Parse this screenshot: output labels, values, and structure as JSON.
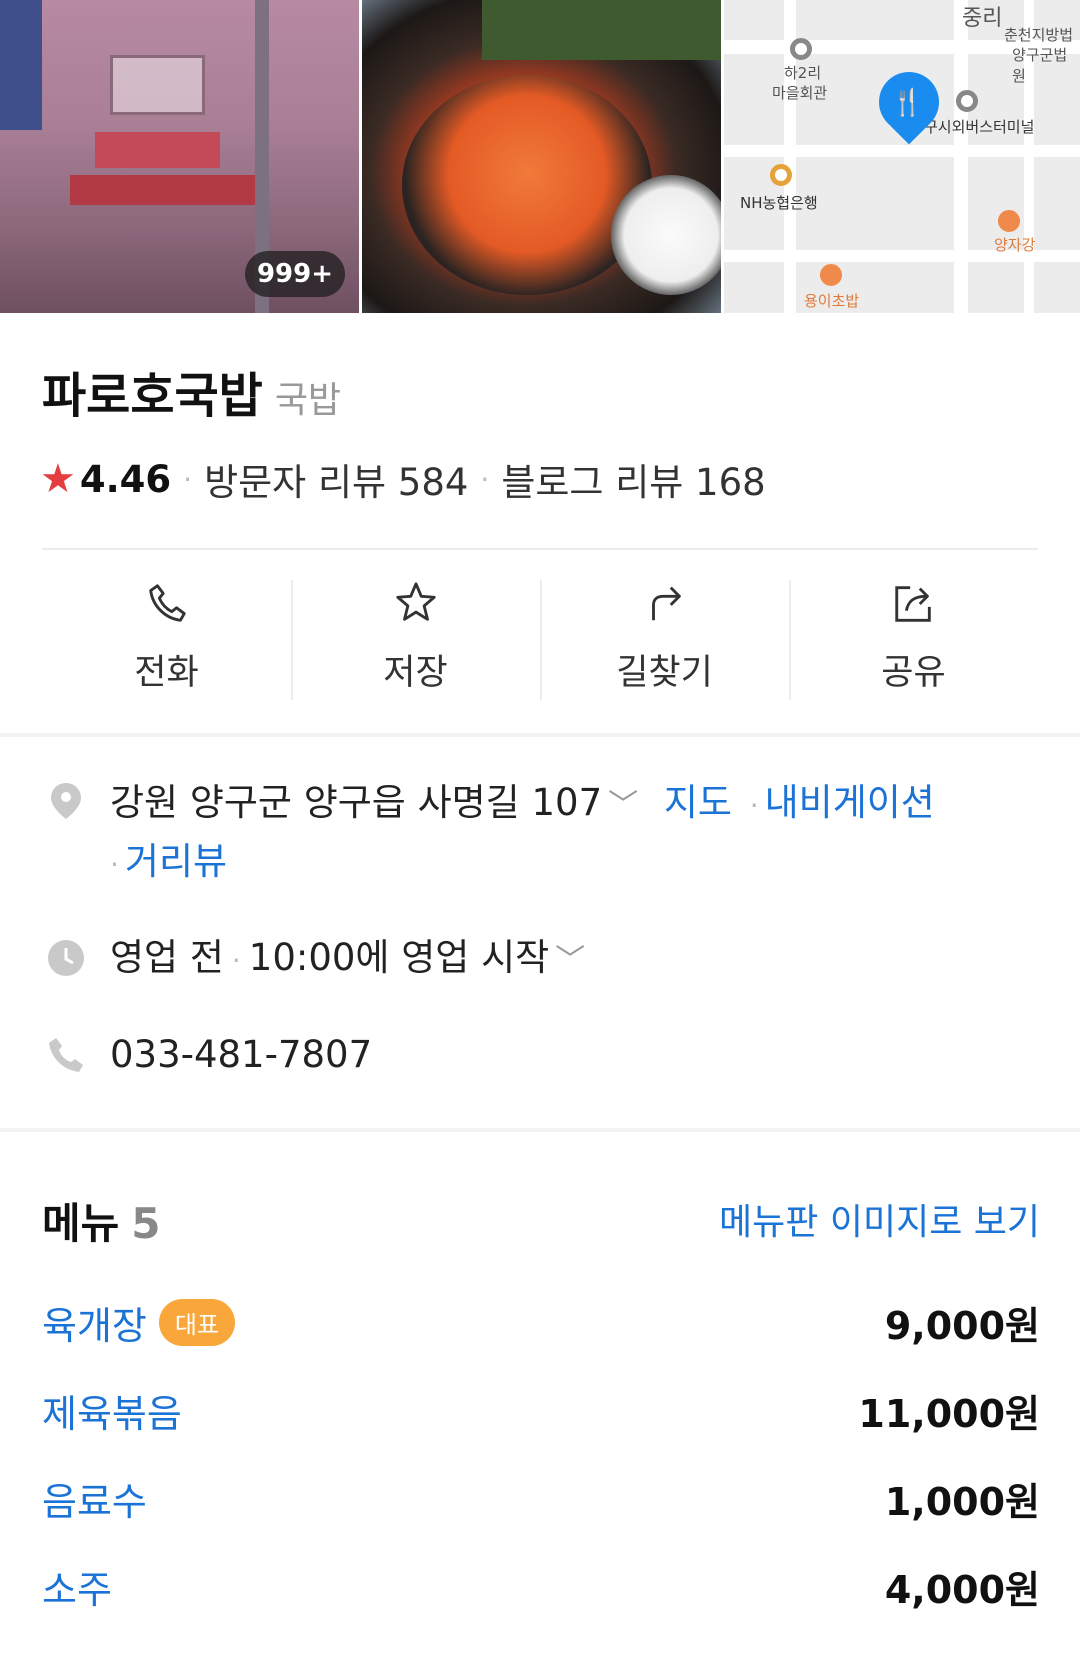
{
  "photos": {
    "count_badge": "999+"
  },
  "map": {
    "labels": [
      "중리",
      "춘천지방법",
      "양구군법원",
      "하2리",
      "마을회관",
      "구시외버스터미널",
      "NH농협은행",
      "양자강",
      "용이초밥"
    ]
  },
  "place": {
    "name": "파로호국밥",
    "category": "국밥",
    "rating": "4.46",
    "visitor_reviews": "방문자 리뷰 584",
    "blog_reviews": "블로그 리뷰 168"
  },
  "actions": [
    {
      "label": "전화",
      "icon": "phone-icon"
    },
    {
      "label": "저장",
      "icon": "star-icon"
    },
    {
      "label": "길찾기",
      "icon": "directions-icon"
    },
    {
      "label": "공유",
      "icon": "share-icon"
    }
  ],
  "info": {
    "address": "강원 양구군 양구읍 사명길 107",
    "map_link": "지도",
    "navigation_link": "내비게이션",
    "street_view_link": "거리뷰",
    "hours_status": "영업 전",
    "hours_detail": "10:00에 영업 시작",
    "phone": "033-481-7807"
  },
  "menu": {
    "title": "메뉴",
    "count": "5",
    "image_link": "메뉴판 이미지로 보기",
    "items": [
      {
        "name": "육개장",
        "badge": "대표",
        "price": "9,000원"
      },
      {
        "name": "제육볶음",
        "badge": "",
        "price": "11,000원"
      },
      {
        "name": "음료수",
        "badge": "",
        "price": "1,000원"
      },
      {
        "name": "소주",
        "badge": "",
        "price": "4,000원"
      }
    ]
  },
  "colors": {
    "link": "#1b73d6",
    "star": "#e53e3e",
    "badge": "#f9a63a",
    "pin": "#1a8cf0"
  }
}
